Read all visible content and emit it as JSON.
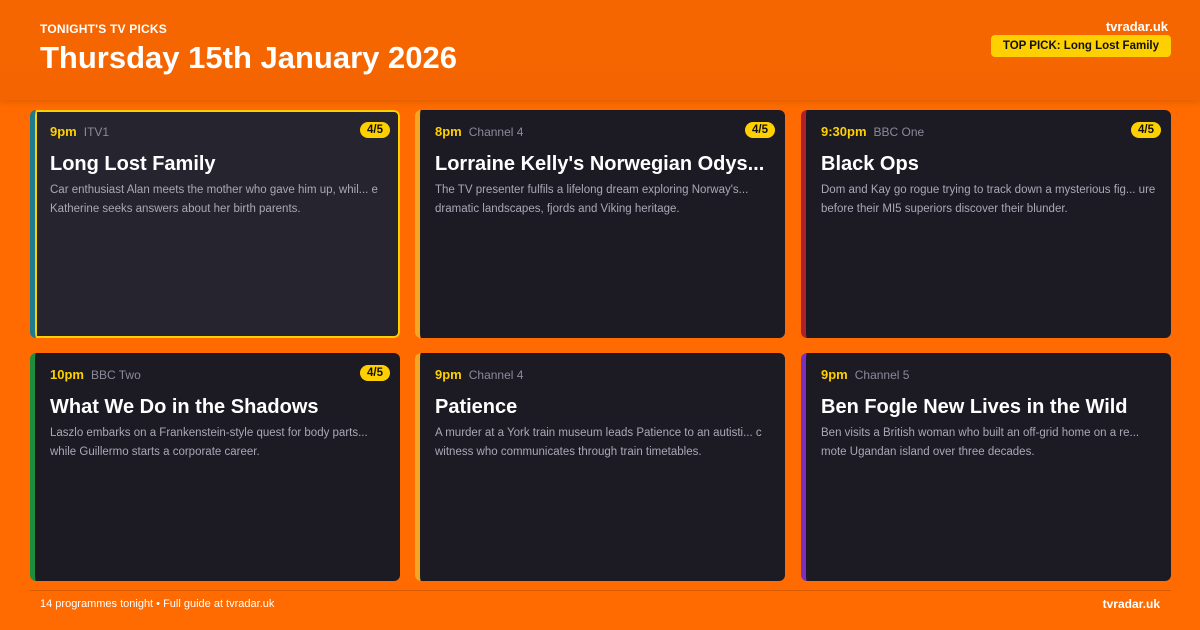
{
  "header": {
    "kicker": "TONIGHT'S TV PICKS",
    "date": "Thursday 15th January 2026",
    "brand": "tvradar.uk",
    "top_pick": "TOP PICK: Long Lost Family"
  },
  "cards": [
    {
      "time": "9pm",
      "channel": "ITV1",
      "rating": "4/5",
      "title": "Long Lost Family",
      "description": "Car enthusiast Alan meets the mother who gave him up, whil... e Katherine seeks answers about her birth parents.",
      "accent": "#1F7A8C",
      "highlight": true
    },
    {
      "time": "8pm",
      "channel": "Channel 4",
      "rating": "4/5",
      "title": "Lorraine Kelly's Norwegian Odys...",
      "description": "The TV presenter fulfils a lifelong dream exploring Norway's... dramatic landscapes, fjords and Viking heritage.",
      "accent": "#F5A623",
      "highlight": false
    },
    {
      "time": "9:30pm",
      "channel": "BBC One",
      "rating": "4/5",
      "title": "Black Ops",
      "description": "Dom and Kay go rogue trying to track down a mysterious fig... ure before their MI5 superiors discover their blunder.",
      "accent": "#B0202A",
      "highlight": false
    },
    {
      "time": "10pm",
      "channel": "BBC Two",
      "rating": "4/5",
      "title": "What We Do in the Shadows",
      "description": "Laszlo embarks on a Frankenstein-style quest for body parts... while Guillermo starts a corporate career.",
      "accent": "#1E8E3E",
      "highlight": false
    },
    {
      "time": "9pm",
      "channel": "Channel 4",
      "rating": "",
      "title": "Patience",
      "description": "A murder at a York train museum leads Patience to an autisti... c witness who communicates through train timetables.",
      "accent": "#F5A623",
      "highlight": false
    },
    {
      "time": "9pm",
      "channel": "Channel 5",
      "rating": "",
      "title": "Ben Fogle New Lives in the Wild",
      "description": "Ben visits a British woman who built an off-grid home on a re... mote Ugandan island over three decades.",
      "accent": "#7B2FBE",
      "highlight": false
    }
  ],
  "footer": {
    "summary": "14 programmes tonight • Full guide at tvradar.uk",
    "brand": "tvradar.uk"
  }
}
